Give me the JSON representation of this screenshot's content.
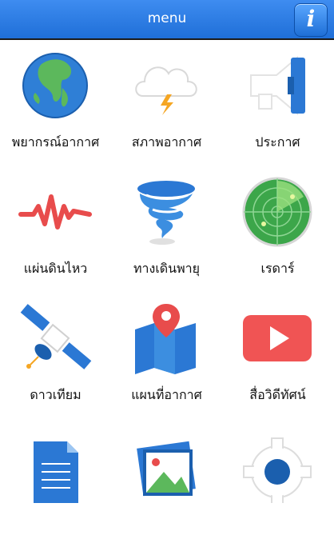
{
  "header": {
    "title": "menu",
    "info_icon": "info-icon"
  },
  "menu": {
    "items": [
      {
        "label": "พยากรณ์อากาศ",
        "icon": "globe-icon"
      },
      {
        "label": "สภาพอากาศ",
        "icon": "cloud-lightning-icon"
      },
      {
        "label": "ประกาศ",
        "icon": "megaphone-icon"
      },
      {
        "label": "แผ่นดินไหว",
        "icon": "seismograph-icon"
      },
      {
        "label": "ทางเดินพายุ",
        "icon": "tornado-icon"
      },
      {
        "label": "เรดาร์",
        "icon": "radar-icon"
      },
      {
        "label": "ดาวเทียม",
        "icon": "satellite-icon"
      },
      {
        "label": "แผนที่อากาศ",
        "icon": "map-pin-icon"
      },
      {
        "label": "สื่อวิดีทัศน์",
        "icon": "video-play-icon"
      },
      {
        "label": "",
        "icon": "document-icon"
      },
      {
        "label": "",
        "icon": "image-gallery-icon"
      },
      {
        "label": "",
        "icon": "gear-icon"
      }
    ]
  },
  "colors": {
    "header": "#2a7be4",
    "accent_blue": "#2b78d4",
    "red": "#f05454"
  }
}
